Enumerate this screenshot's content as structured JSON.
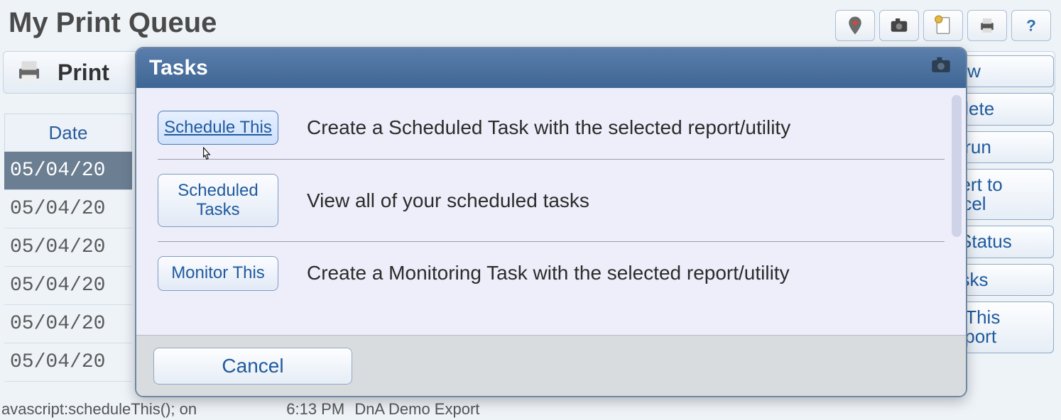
{
  "header": {
    "page_title": "My Print Queue",
    "print_label": "Print"
  },
  "toolbar_icons": [
    "map-pin-icon",
    "camera-icon",
    "schedule-page-icon",
    "printer-icon",
    "help-icon"
  ],
  "table": {
    "date_header": "Date",
    "rows": [
      {
        "date": "05/04/20",
        "selected": true
      },
      {
        "date": "05/04/20"
      },
      {
        "date": "05/04/20"
      },
      {
        "date": "05/04/20"
      },
      {
        "date": "05/04/20"
      },
      {
        "date": "05/04/20"
      }
    ]
  },
  "statusbar": {
    "text": "avascript:scheduleThis(); on",
    "time": "6:13 PM",
    "name": "DnA Demo Export"
  },
  "side_buttons": [
    "View",
    "Delete",
    "Rerun",
    "nvert to Excel",
    "w Status",
    "Tasks",
    "ve This Report"
  ],
  "modal": {
    "title": "Tasks",
    "items": [
      {
        "button": "Schedule This",
        "desc": "Create a Scheduled Task with the selected report/utility",
        "hover": true
      },
      {
        "button": "Scheduled Tasks",
        "desc": "View all of your scheduled tasks"
      },
      {
        "button": "Monitor This",
        "desc": "Create a Monitoring Task with the selected report/utility"
      }
    ],
    "cancel": "Cancel"
  }
}
